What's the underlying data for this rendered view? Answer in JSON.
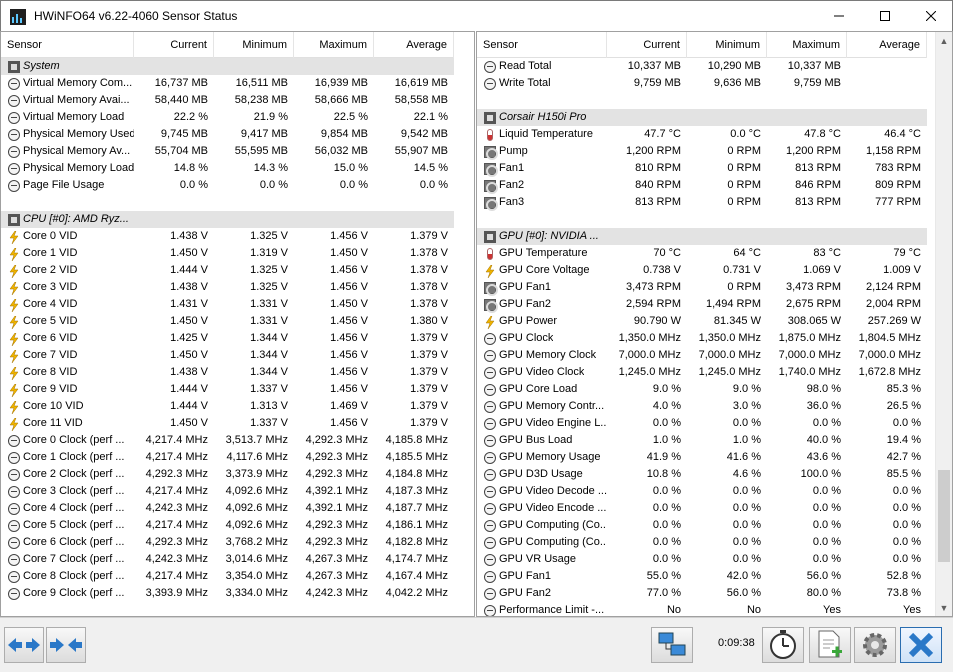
{
  "window": {
    "title": "HWiNFO64 v6.22-4060 Sensor Status",
    "minimize_icon": "minimize-icon",
    "maximize_icon": "maximize-icon",
    "close_icon": "close-icon"
  },
  "columns": [
    "Sensor",
    "Current",
    "Minimum",
    "Maximum",
    "Average"
  ],
  "left_pane": {
    "rows": [
      {
        "type": "group",
        "icon": "chip",
        "name": "System"
      },
      {
        "type": "sensor",
        "icon": "clock",
        "name": "Virtual Memory Com...",
        "current": "16,737 MB",
        "minimum": "16,511 MB",
        "maximum": "16,939 MB",
        "average": "16,619 MB"
      },
      {
        "type": "sensor",
        "icon": "clock",
        "name": "Virtual Memory Avai...",
        "current": "58,440 MB",
        "minimum": "58,238 MB",
        "maximum": "58,666 MB",
        "average": "58,558 MB"
      },
      {
        "type": "sensor",
        "icon": "clock",
        "name": "Virtual Memory Load",
        "current": "22.2 %",
        "minimum": "21.9 %",
        "maximum": "22.5 %",
        "average": "22.1 %"
      },
      {
        "type": "sensor",
        "icon": "clock",
        "name": "Physical Memory Used",
        "current": "9,745 MB",
        "minimum": "9,417 MB",
        "maximum": "9,854 MB",
        "average": "9,542 MB"
      },
      {
        "type": "sensor",
        "icon": "clock",
        "name": "Physical Memory Av...",
        "current": "55,704 MB",
        "minimum": "55,595 MB",
        "maximum": "56,032 MB",
        "average": "55,907 MB"
      },
      {
        "type": "sensor",
        "icon": "clock",
        "name": "Physical Memory Load",
        "current": "14.8 %",
        "minimum": "14.3 %",
        "maximum": "15.0 %",
        "average": "14.5 %"
      },
      {
        "type": "sensor",
        "icon": "clock",
        "name": "Page File Usage",
        "current": "0.0 %",
        "minimum": "0.0 %",
        "maximum": "0.0 %",
        "average": "0.0 %"
      },
      {
        "type": "blank"
      },
      {
        "type": "group",
        "icon": "chip",
        "name": "CPU [#0]: AMD Ryz..."
      },
      {
        "type": "sensor",
        "icon": "volt",
        "name": "Core 0 VID",
        "current": "1.438 V",
        "minimum": "1.325 V",
        "maximum": "1.456 V",
        "average": "1.379 V"
      },
      {
        "type": "sensor",
        "icon": "volt",
        "name": "Core 1 VID",
        "current": "1.450 V",
        "minimum": "1.319 V",
        "maximum": "1.450 V",
        "average": "1.378 V"
      },
      {
        "type": "sensor",
        "icon": "volt",
        "name": "Core 2 VID",
        "current": "1.444 V",
        "minimum": "1.325 V",
        "maximum": "1.456 V",
        "average": "1.378 V"
      },
      {
        "type": "sensor",
        "icon": "volt",
        "name": "Core 3 VID",
        "current": "1.438 V",
        "minimum": "1.325 V",
        "maximum": "1.456 V",
        "average": "1.378 V"
      },
      {
        "type": "sensor",
        "icon": "volt",
        "name": "Core 4 VID",
        "current": "1.431 V",
        "minimum": "1.331 V",
        "maximum": "1.450 V",
        "average": "1.378 V"
      },
      {
        "type": "sensor",
        "icon": "volt",
        "name": "Core 5 VID",
        "current": "1.450 V",
        "minimum": "1.331 V",
        "maximum": "1.456 V",
        "average": "1.380 V"
      },
      {
        "type": "sensor",
        "icon": "volt",
        "name": "Core 6 VID",
        "current": "1.425 V",
        "minimum": "1.344 V",
        "maximum": "1.456 V",
        "average": "1.379 V"
      },
      {
        "type": "sensor",
        "icon": "volt",
        "name": "Core 7 VID",
        "current": "1.450 V",
        "minimum": "1.344 V",
        "maximum": "1.456 V",
        "average": "1.379 V"
      },
      {
        "type": "sensor",
        "icon": "volt",
        "name": "Core 8 VID",
        "current": "1.438 V",
        "minimum": "1.344 V",
        "maximum": "1.456 V",
        "average": "1.379 V"
      },
      {
        "type": "sensor",
        "icon": "volt",
        "name": "Core 9 VID",
        "current": "1.444 V",
        "minimum": "1.337 V",
        "maximum": "1.456 V",
        "average": "1.379 V"
      },
      {
        "type": "sensor",
        "icon": "volt",
        "name": "Core 10 VID",
        "current": "1.444 V",
        "minimum": "1.313 V",
        "maximum": "1.469 V",
        "average": "1.379 V"
      },
      {
        "type": "sensor",
        "icon": "volt",
        "name": "Core 11 VID",
        "current": "1.450 V",
        "minimum": "1.337 V",
        "maximum": "1.456 V",
        "average": "1.379 V"
      },
      {
        "type": "sensor",
        "icon": "clock",
        "name": "Core 0 Clock (perf ...",
        "current": "4,217.4 MHz",
        "minimum": "3,513.7 MHz",
        "maximum": "4,292.3 MHz",
        "average": "4,185.8 MHz"
      },
      {
        "type": "sensor",
        "icon": "clock",
        "name": "Core 1 Clock (perf ...",
        "current": "4,217.4 MHz",
        "minimum": "4,117.6 MHz",
        "maximum": "4,292.3 MHz",
        "average": "4,185.5 MHz"
      },
      {
        "type": "sensor",
        "icon": "clock",
        "name": "Core 2 Clock (perf ...",
        "current": "4,292.3 MHz",
        "minimum": "3,373.9 MHz",
        "maximum": "4,292.3 MHz",
        "average": "4,184.8 MHz"
      },
      {
        "type": "sensor",
        "icon": "clock",
        "name": "Core 3 Clock (perf ...",
        "current": "4,217.4 MHz",
        "minimum": "4,092.6 MHz",
        "maximum": "4,392.1 MHz",
        "average": "4,187.3 MHz"
      },
      {
        "type": "sensor",
        "icon": "clock",
        "name": "Core 4 Clock (perf ...",
        "current": "4,242.3 MHz",
        "minimum": "4,092.6 MHz",
        "maximum": "4,392.1 MHz",
        "average": "4,187.7 MHz"
      },
      {
        "type": "sensor",
        "icon": "clock",
        "name": "Core 5 Clock (perf ...",
        "current": "4,217.4 MHz",
        "minimum": "4,092.6 MHz",
        "maximum": "4,292.3 MHz",
        "average": "4,186.1 MHz"
      },
      {
        "type": "sensor",
        "icon": "clock",
        "name": "Core 6 Clock (perf ...",
        "current": "4,292.3 MHz",
        "minimum": "3,768.2 MHz",
        "maximum": "4,292.3 MHz",
        "average": "4,182.8 MHz"
      },
      {
        "type": "sensor",
        "icon": "clock",
        "name": "Core 7 Clock (perf ...",
        "current": "4,242.3 MHz",
        "minimum": "3,014.6 MHz",
        "maximum": "4,267.3 MHz",
        "average": "4,174.7 MHz"
      },
      {
        "type": "sensor",
        "icon": "clock",
        "name": "Core 8 Clock (perf ...",
        "current": "4,217.4 MHz",
        "minimum": "3,354.0 MHz",
        "maximum": "4,267.3 MHz",
        "average": "4,167.4 MHz"
      },
      {
        "type": "sensor",
        "icon": "clock",
        "name": "Core 9 Clock (perf ...",
        "current": "3,393.9 MHz",
        "minimum": "3,334.0 MHz",
        "maximum": "4,242.3 MHz",
        "average": "4,042.2 MHz"
      }
    ]
  },
  "right_pane": {
    "rows": [
      {
        "type": "sensor",
        "icon": "clock",
        "name": "Read Total",
        "current": "10,337 MB",
        "minimum": "10,290 MB",
        "maximum": "10,337 MB",
        "average": ""
      },
      {
        "type": "sensor",
        "icon": "clock",
        "name": "Write Total",
        "current": "9,759 MB",
        "minimum": "9,636 MB",
        "maximum": "9,759 MB",
        "average": ""
      },
      {
        "type": "blank"
      },
      {
        "type": "group",
        "icon": "chip",
        "name": "Corsair H150i Pro"
      },
      {
        "type": "sensor",
        "icon": "temp",
        "name": "Liquid Temperature",
        "current": "47.7 °C",
        "minimum": "0.0 °C",
        "maximum": "47.8 °C",
        "average": "46.4 °C"
      },
      {
        "type": "sensor",
        "icon": "fan",
        "name": "Pump",
        "current": "1,200 RPM",
        "minimum": "0 RPM",
        "maximum": "1,200 RPM",
        "average": "1,158 RPM"
      },
      {
        "type": "sensor",
        "icon": "fan",
        "name": "Fan1",
        "current": "810 RPM",
        "minimum": "0 RPM",
        "maximum": "813 RPM",
        "average": "783 RPM"
      },
      {
        "type": "sensor",
        "icon": "fan",
        "name": "Fan2",
        "current": "840 RPM",
        "minimum": "0 RPM",
        "maximum": "846 RPM",
        "average": "809 RPM"
      },
      {
        "type": "sensor",
        "icon": "fan",
        "name": "Fan3",
        "current": "813 RPM",
        "minimum": "0 RPM",
        "maximum": "813 RPM",
        "average": "777 RPM"
      },
      {
        "type": "blank"
      },
      {
        "type": "group",
        "icon": "chip",
        "name": "GPU [#0]: NVIDIA ..."
      },
      {
        "type": "sensor",
        "icon": "temp",
        "name": "GPU Temperature",
        "current": "70 °C",
        "minimum": "64 °C",
        "maximum": "83 °C",
        "average": "79 °C"
      },
      {
        "type": "sensor",
        "icon": "volt",
        "name": "GPU Core Voltage",
        "current": "0.738 V",
        "minimum": "0.731 V",
        "maximum": "1.069 V",
        "average": "1.009 V"
      },
      {
        "type": "sensor",
        "icon": "fan",
        "name": "GPU Fan1",
        "current": "3,473 RPM",
        "minimum": "0 RPM",
        "maximum": "3,473 RPM",
        "average": "2,124 RPM"
      },
      {
        "type": "sensor",
        "icon": "fan",
        "name": "GPU Fan2",
        "current": "2,594 RPM",
        "minimum": "1,494 RPM",
        "maximum": "2,675 RPM",
        "average": "2,004 RPM"
      },
      {
        "type": "sensor",
        "icon": "volt",
        "name": "GPU Power",
        "current": "90.790 W",
        "minimum": "81.345 W",
        "maximum": "308.065 W",
        "average": "257.269 W"
      },
      {
        "type": "sensor",
        "icon": "clock",
        "name": "GPU Clock",
        "current": "1,350.0 MHz",
        "minimum": "1,350.0 MHz",
        "maximum": "1,875.0 MHz",
        "average": "1,804.5 MHz"
      },
      {
        "type": "sensor",
        "icon": "clock",
        "name": "GPU Memory Clock",
        "current": "7,000.0 MHz",
        "minimum": "7,000.0 MHz",
        "maximum": "7,000.0 MHz",
        "average": "7,000.0 MHz"
      },
      {
        "type": "sensor",
        "icon": "clock",
        "name": "GPU Video Clock",
        "current": "1,245.0 MHz",
        "minimum": "1,245.0 MHz",
        "maximum": "1,740.0 MHz",
        "average": "1,672.8 MHz"
      },
      {
        "type": "sensor",
        "icon": "clock",
        "name": "GPU Core Load",
        "current": "9.0 %",
        "minimum": "9.0 %",
        "maximum": "98.0 %",
        "average": "85.3 %"
      },
      {
        "type": "sensor",
        "icon": "clock",
        "name": "GPU Memory Contr...",
        "current": "4.0 %",
        "minimum": "3.0 %",
        "maximum": "36.0 %",
        "average": "26.5 %"
      },
      {
        "type": "sensor",
        "icon": "clock",
        "name": "GPU Video Engine L...",
        "current": "0.0 %",
        "minimum": "0.0 %",
        "maximum": "0.0 %",
        "average": "0.0 %"
      },
      {
        "type": "sensor",
        "icon": "clock",
        "name": "GPU Bus Load",
        "current": "1.0 %",
        "minimum": "1.0 %",
        "maximum": "40.0 %",
        "average": "19.4 %"
      },
      {
        "type": "sensor",
        "icon": "clock",
        "name": "GPU Memory Usage",
        "current": "41.9 %",
        "minimum": "41.6 %",
        "maximum": "43.6 %",
        "average": "42.7 %"
      },
      {
        "type": "sensor",
        "icon": "clock",
        "name": "GPU D3D Usage",
        "current": "10.8 %",
        "minimum": "4.6 %",
        "maximum": "100.0 %",
        "average": "85.5 %"
      },
      {
        "type": "sensor",
        "icon": "clock",
        "name": "GPU Video Decode ...",
        "current": "0.0 %",
        "minimum": "0.0 %",
        "maximum": "0.0 %",
        "average": "0.0 %"
      },
      {
        "type": "sensor",
        "icon": "clock",
        "name": "GPU Video Encode ...",
        "current": "0.0 %",
        "minimum": "0.0 %",
        "maximum": "0.0 %",
        "average": "0.0 %"
      },
      {
        "type": "sensor",
        "icon": "clock",
        "name": "GPU Computing (Co...",
        "current": "0.0 %",
        "minimum": "0.0 %",
        "maximum": "0.0 %",
        "average": "0.0 %"
      },
      {
        "type": "sensor",
        "icon": "clock",
        "name": "GPU Computing (Co...",
        "current": "0.0 %",
        "minimum": "0.0 %",
        "maximum": "0.0 %",
        "average": "0.0 %"
      },
      {
        "type": "sensor",
        "icon": "clock",
        "name": "GPU VR Usage",
        "current": "0.0 %",
        "minimum": "0.0 %",
        "maximum": "0.0 %",
        "average": "0.0 %"
      },
      {
        "type": "sensor",
        "icon": "clock",
        "name": "GPU Fan1",
        "current": "55.0 %",
        "minimum": "42.0 %",
        "maximum": "56.0 %",
        "average": "52.8 %"
      },
      {
        "type": "sensor",
        "icon": "clock",
        "name": "GPU Fan2",
        "current": "77.0 %",
        "minimum": "56.0 %",
        "maximum": "80.0 %",
        "average": "73.8 %"
      },
      {
        "type": "sensor",
        "icon": "clock",
        "name": "Performance Limit -...",
        "current": "No",
        "minimum": "No",
        "maximum": "Yes",
        "average": "Yes"
      }
    ]
  },
  "statusbar": {
    "elapsed_time": "0:09:38",
    "buttons": [
      "prev-arrows-icon",
      "next-arrows-icon",
      "network-icon",
      "stopwatch-icon",
      "add-report-icon",
      "settings-gear-icon",
      "close-x-icon"
    ]
  }
}
